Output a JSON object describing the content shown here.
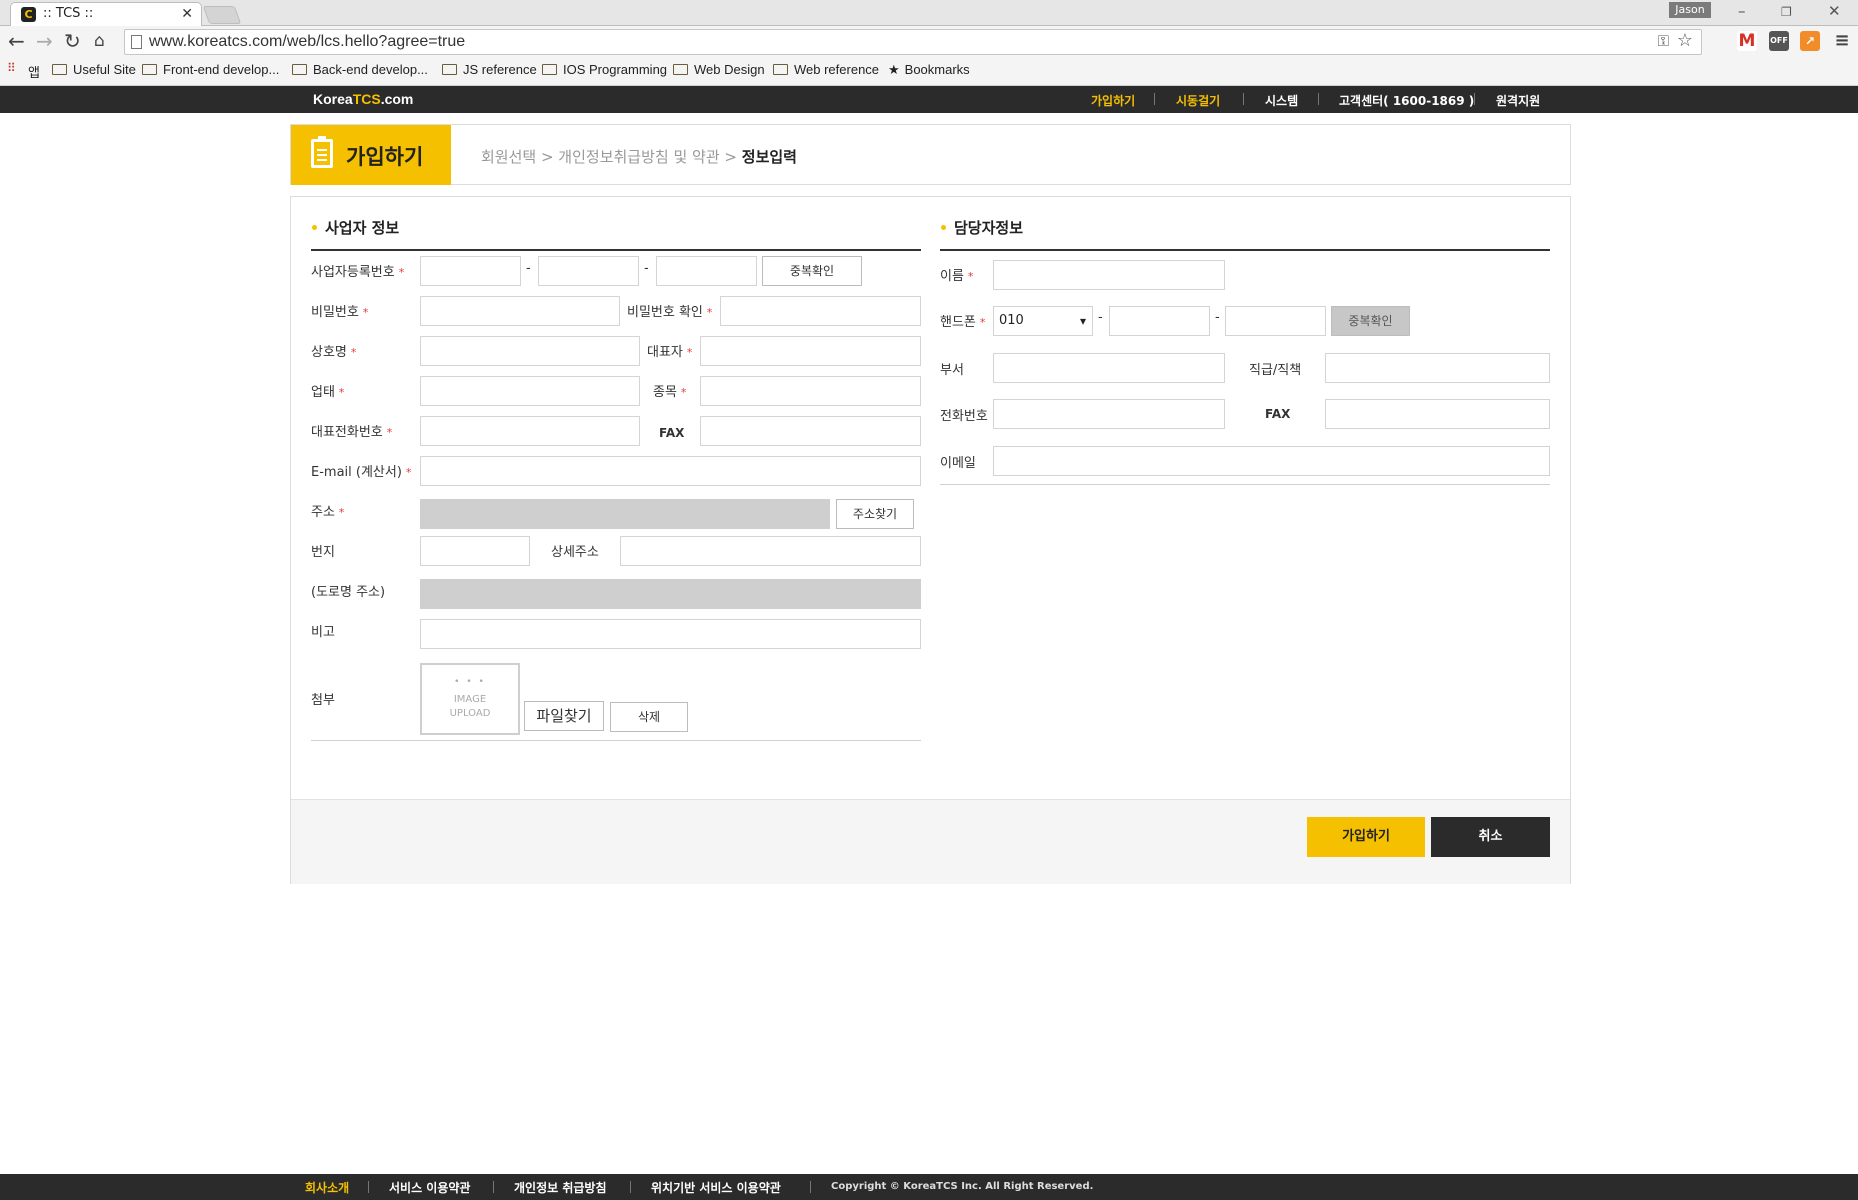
{
  "browser": {
    "tab_title": ":: TCS ::",
    "url": "www.koreatcs.com/web/lcs.hello?agree=true",
    "user": "Jason",
    "apps_label": "앱",
    "bookmarks": [
      "Useful Site",
      "Front-end develop...",
      "Back-end develop...",
      "JS reference",
      "IOS Programming",
      "Web Design",
      "Web reference",
      "Bookmarks"
    ]
  },
  "site": {
    "logo_prefix": "Korea",
    "logo_suffix": "TCS",
    "logo_tail": ".com",
    "nav": [
      "가입하기",
      "시동걸기",
      "시스템",
      "고객센터( 1600-1869 )",
      "원격지원"
    ]
  },
  "header": {
    "title": "가입하기",
    "crumb_1": "회원선택 > 개인정보취급방침 및 약관 >",
    "crumb_current": "정보입력"
  },
  "business": {
    "title": "사업자 정보",
    "reg_no": "사업자등록번호",
    "dup_check": "중복확인",
    "password": "비밀번호",
    "password_confirm": "비밀번호 확인",
    "company": "상호명",
    "ceo": "대표자",
    "biz_type": "업태",
    "biz_item": "종목",
    "phone": "대표전화번호",
    "fax": "FAX",
    "email": "E-mail (계산서)",
    "address": "주소",
    "address_search": "주소찾기",
    "lot": "번지",
    "address_detail": "상세주소",
    "road": "(도로명 주소)",
    "note": "비고",
    "attach": "첨부",
    "upload_1": "IMAGE",
    "upload_2": "UPLOAD",
    "file_find": "파일찾기",
    "delete": "삭제"
  },
  "manager": {
    "title": "담당자정보",
    "name": "이름",
    "mobile": "핸드폰",
    "mobile_prefix": "010",
    "dup_check": "중복확인",
    "dept": "부서",
    "position": "직급/직책",
    "phone": "전화번호",
    "fax": "FAX",
    "email": "이메일"
  },
  "actions": {
    "submit": "가입하기",
    "cancel": "취소"
  },
  "footer": {
    "links": [
      "회사소개",
      "서비스 이용약관",
      "개인정보 취급방침",
      "위치기반 서비스 이용약관"
    ],
    "copyright": "Copyright © KoreaTCS Inc. All Right Reserved."
  },
  "colors": {
    "accent": "#f5c000",
    "dark": "#2b2b2b",
    "required": "#e53935"
  }
}
